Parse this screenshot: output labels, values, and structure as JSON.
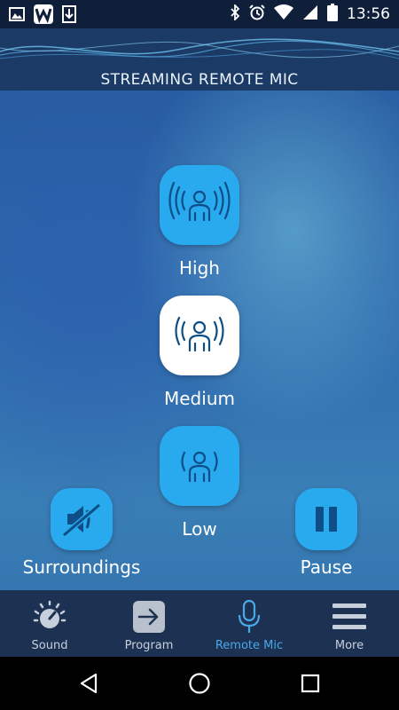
{
  "status_bar": {
    "time": "13:56",
    "icons": [
      "image-icon",
      "app-w-icon",
      "download-icon",
      "bluetooth-icon",
      "alarm-icon",
      "wifi-icon",
      "signal-icon",
      "battery-icon"
    ]
  },
  "header": {
    "title": "STREAMING REMOTE MIC"
  },
  "levels": [
    {
      "label": "High",
      "selected": false,
      "icon": "person-waves-high-icon"
    },
    {
      "label": "Medium",
      "selected": true,
      "icon": "person-waves-medium-icon"
    },
    {
      "label": "Low",
      "selected": false,
      "icon": "person-waves-low-icon"
    }
  ],
  "controls": {
    "surroundings": {
      "label": "Surroundings",
      "icon": "speaker-muted-icon"
    },
    "pause": {
      "label": "Pause",
      "icon": "pause-icon"
    }
  },
  "tabs": [
    {
      "label": "Sound",
      "icon": "volume-dial-icon",
      "active": false
    },
    {
      "label": "Program",
      "icon": "arrow-right-icon",
      "active": false
    },
    {
      "label": "Remote Mic",
      "icon": "microphone-icon",
      "active": true
    },
    {
      "label": "More",
      "icon": "menu-icon",
      "active": false
    }
  ],
  "colors": {
    "accent": "#29a9ee",
    "active_tab": "#4aa8e8",
    "tab_bar": "#1d3252"
  }
}
